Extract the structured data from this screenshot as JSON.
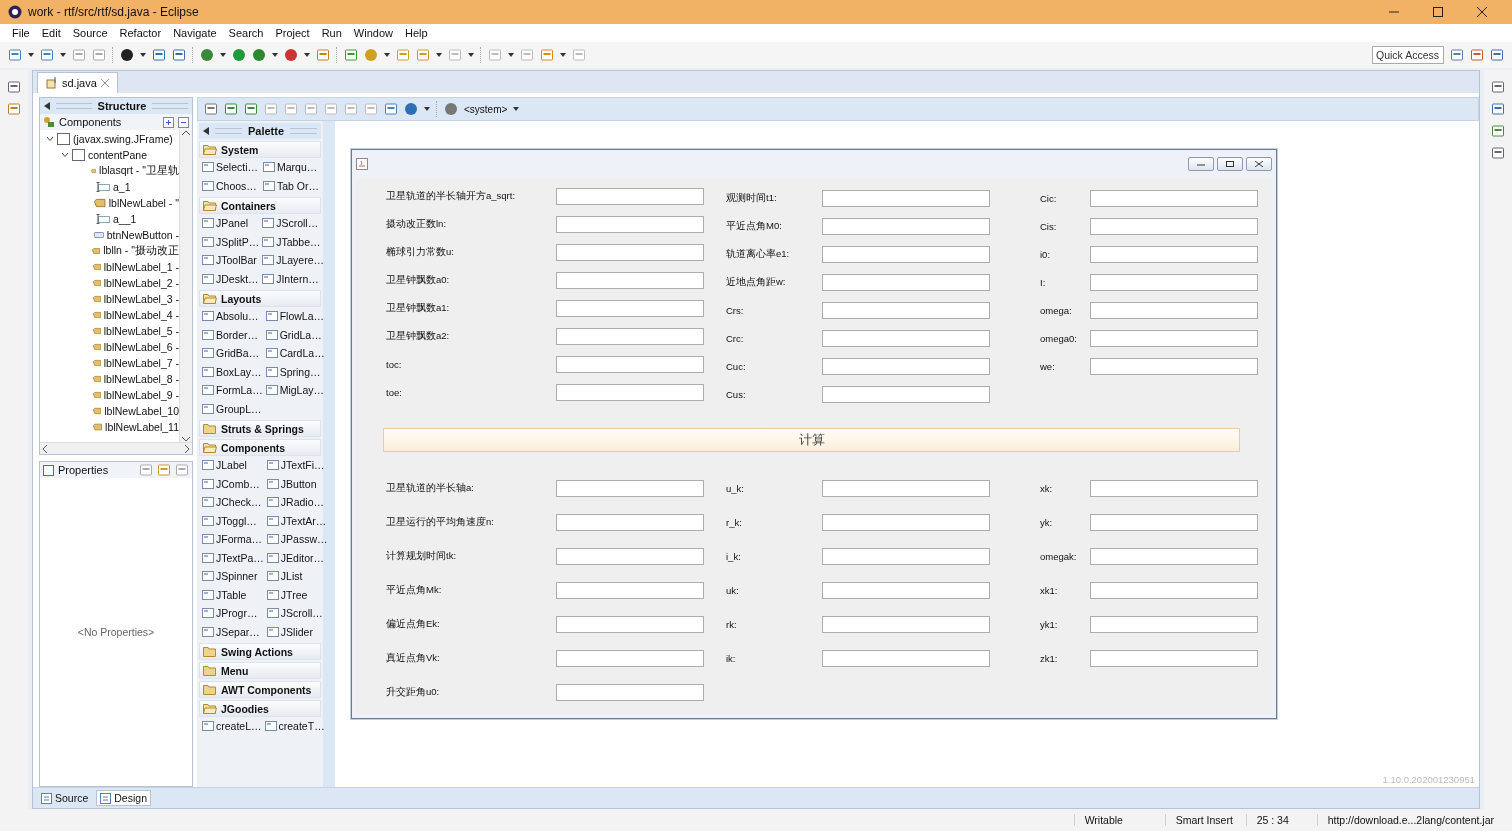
{
  "window": {
    "title": "work - rtf/src/rtf/sd.java - Eclipse"
  },
  "menu": [
    "File",
    "Edit",
    "Source",
    "Refactor",
    "Navigate",
    "Search",
    "Project",
    "Run",
    "Window",
    "Help"
  ],
  "quick_access": {
    "placeholder": "Quick Access"
  },
  "editor_tab": "sd.java",
  "structure": {
    "title": "Structure",
    "components_title": "Components",
    "tree": [
      {
        "label": "(javax.swing.JFrame)",
        "kind": "frame",
        "expanded": true,
        "children": [
          {
            "label": "contentPane",
            "kind": "frame",
            "expanded": true,
            "children": [
              {
                "label": "lblasqrt - \"卫星轨",
                "kind": "label"
              },
              {
                "label": "a_1",
                "kind": "field"
              },
              {
                "label": "lblNewLabel - \"",
                "kind": "label"
              },
              {
                "label": "a__1",
                "kind": "field"
              },
              {
                "label": "btnNewButton -",
                "kind": "button"
              },
              {
                "label": "lblln - \"摄动改正",
                "kind": "label"
              },
              {
                "label": "lblNewLabel_1 -",
                "kind": "label"
              },
              {
                "label": "lblNewLabel_2 -",
                "kind": "label"
              },
              {
                "label": "lblNewLabel_3 -",
                "kind": "label"
              },
              {
                "label": "lblNewLabel_4 -",
                "kind": "label"
              },
              {
                "label": "lblNewLabel_5 -",
                "kind": "label"
              },
              {
                "label": "lblNewLabel_6 -",
                "kind": "label"
              },
              {
                "label": "lblNewLabel_7 -",
                "kind": "label"
              },
              {
                "label": "lblNewLabel_8 -",
                "kind": "label"
              },
              {
                "label": "lblNewLabel_9 -",
                "kind": "label"
              },
              {
                "label": "lblNewLabel_10",
                "kind": "label"
              },
              {
                "label": "lblNewLabel_11",
                "kind": "label"
              }
            ]
          }
        ]
      }
    ]
  },
  "properties": {
    "title": "Properties",
    "empty_text": "<No Properties>"
  },
  "designer_toolbar": {
    "look_and_feel": "<system>"
  },
  "palette": {
    "title": "Palette",
    "categories": [
      {
        "name": "System",
        "expanded": true,
        "items": [
          "Selecti…",
          "Marqu…",
          "Choos…",
          "Tab Or…"
        ]
      },
      {
        "name": "Containers",
        "expanded": true,
        "items": [
          "JPanel",
          "JScroll…",
          "JSplitP…",
          "JTabbe…",
          "JToolBar",
          "JLayere…",
          "JDeskt…",
          "JIntern…"
        ]
      },
      {
        "name": "Layouts",
        "expanded": true,
        "items": [
          "Absolu…",
          "FlowLa…",
          "Border…",
          "GridLa…",
          "GridBa…",
          "CardLa…",
          "BoxLay…",
          "Spring…",
          "FormLa…",
          "MigLay…",
          "GroupL…"
        ]
      },
      {
        "name": "Struts & Springs",
        "expanded": false
      },
      {
        "name": "Components",
        "expanded": true,
        "items": [
          "JLabel",
          "JTextFi…",
          "JComb…",
          "JButton",
          "JCheck…",
          "JRadio…",
          "JToggl…",
          "JTextAr…",
          "JForma…",
          "JPassw…",
          "JTextPa…",
          "JEditor…",
          "JSpinner",
          "JList",
          "JTable",
          "JTree",
          "JProgr…",
          "JScroll…",
          "JSepar…",
          "JSlider"
        ]
      },
      {
        "name": "Swing Actions",
        "expanded": false
      },
      {
        "name": "Menu",
        "expanded": false
      },
      {
        "name": "AWT Components",
        "expanded": false
      },
      {
        "name": "JGoodies",
        "expanded": true,
        "items": [
          "createL…",
          "createT…"
        ]
      }
    ]
  },
  "form": {
    "top_columns": [
      [
        "卫星轨道的半长轴开方a_sqrt:",
        "摄动改正数ln:",
        "椭球引力常数u:",
        "卫星钟飘数a0:",
        "卫星钟飘数a1:",
        "卫星钟飘数a2:",
        "toc:",
        "toe:"
      ],
      [
        "观测时间t1:",
        "平近点角M0:",
        "轨道离心率e1:",
        "近地点角距w:",
        "Crs:",
        "Crc:",
        "Cuc:",
        "Cus:"
      ],
      [
        "Cic:",
        "Cis:",
        "i0:",
        "I:",
        "omega:",
        "omega0:",
        "we:"
      ]
    ],
    "button": "计算",
    "bottom_columns": [
      [
        "卫星轨道的半长轴a:",
        "卫星运行的平均角速度n:",
        "计算规划时间tk:",
        "平近点角Mk:",
        "偏近点角Ek:",
        "真近点角Vk:",
        "升交距角u0:"
      ],
      [
        "u_k:",
        "r_k:",
        "i_k:",
        "uk:",
        "rk:",
        "ik:"
      ],
      [
        "xk:",
        "yk:",
        "omegak:",
        "xk1:",
        "yk1:",
        "zk1:"
      ]
    ]
  },
  "version": "1.10.0.202001230951",
  "bottom_tabs": [
    {
      "label": "Source",
      "selected": false
    },
    {
      "label": "Design",
      "selected": true
    }
  ],
  "status_bar": [
    "Writable",
    "Smart Insert",
    "25 : 34",
    "http://download.e...2lang/content.jar"
  ]
}
